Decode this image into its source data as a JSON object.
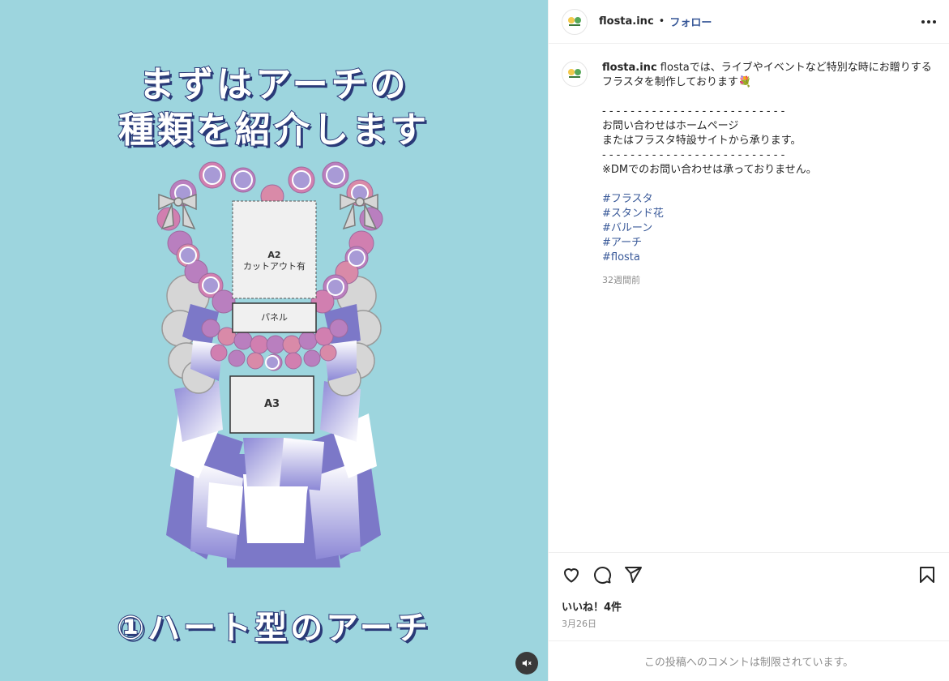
{
  "media": {
    "headline_line1": "まずはアーチの",
    "headline_line2": "種類を紹介します",
    "subtitle": "①ハート型のアーチ",
    "box_a2_line1": "A2",
    "box_a2_line2": "カットアウト有",
    "box_panel": "パネル",
    "box_a3": "A3",
    "mute_icon": "speaker-muted-icon",
    "background_color": "#9dd5de"
  },
  "header": {
    "username": "flosta.inc",
    "separator": "•",
    "follow_label": "フォロー",
    "more_icon": "more-horizontal-icon"
  },
  "caption": {
    "username": "flosta.inc",
    "lines": [
      "flostaでは、ライブやイベントなど特別な時にお贈りする",
      "フラスタを制作しております💐",
      "",
      "- - - - - - - - - - - - - - - - - - - - - - - - - -",
      "お問い合わせはホームページ",
      "またはフラスタ特設サイトから承ります。",
      "- - - - - - - - - - - - - - - - - - - - - - - - - -",
      "※DMでのお問い合わせは承っておりません。"
    ],
    "hashtags": [
      "#フラスタ",
      "#スタンド花",
      "#バルーン",
      "#アーチ",
      "#flosta"
    ],
    "time_ago": "32週間前"
  },
  "actions": {
    "like_icon": "heart-icon",
    "comment_icon": "comment-icon",
    "share_icon": "send-icon",
    "save_icon": "bookmark-icon",
    "likes_text": "いいね！4件",
    "date": "3月26日"
  },
  "footer": {
    "restricted_text": "この投稿へのコメントは制限されています。"
  }
}
